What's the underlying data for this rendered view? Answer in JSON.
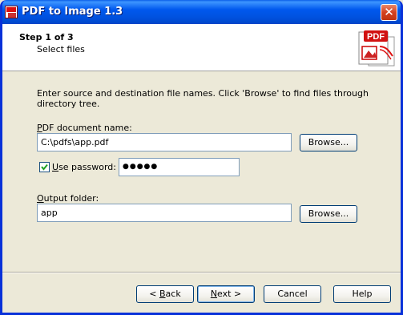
{
  "window": {
    "title": "PDF to Image 1.3",
    "close_glyph": "✕"
  },
  "header": {
    "step": "Step 1 of 3",
    "subtitle": "Select files"
  },
  "instructions": "Enter source and destination file names. Click 'Browse' to find files through directory tree.",
  "pdf_field": {
    "label_accel": "P",
    "label_rest": "DF document name:",
    "value": "C:\\pdfs\\app.pdf",
    "browse_label": "Browse..."
  },
  "password": {
    "checked": true,
    "label_accel": "U",
    "label_rest": "se password:",
    "masked_value": "●●●●●"
  },
  "output_field": {
    "label_accel": "O",
    "label_rest": "utput folder:",
    "value": "app",
    "browse_label": "Browse..."
  },
  "footer": {
    "back_prefix": "< ",
    "back_accel": "B",
    "back_rest": "ack",
    "next_accel": "N",
    "next_rest": "ext >",
    "cancel_label": "Cancel",
    "help_label": "Help"
  },
  "colors": {
    "titlebar": "#0058ee",
    "dialog_bg": "#ece9d8",
    "header_bg": "#ffffff",
    "close_button": "#d4401f",
    "pdf_badge": "#d11111"
  },
  "icons": {
    "app": "pdf-to-image-icon",
    "logo": "pdf-to-image-logo",
    "close": "close-icon",
    "check": "checkmark-icon"
  }
}
